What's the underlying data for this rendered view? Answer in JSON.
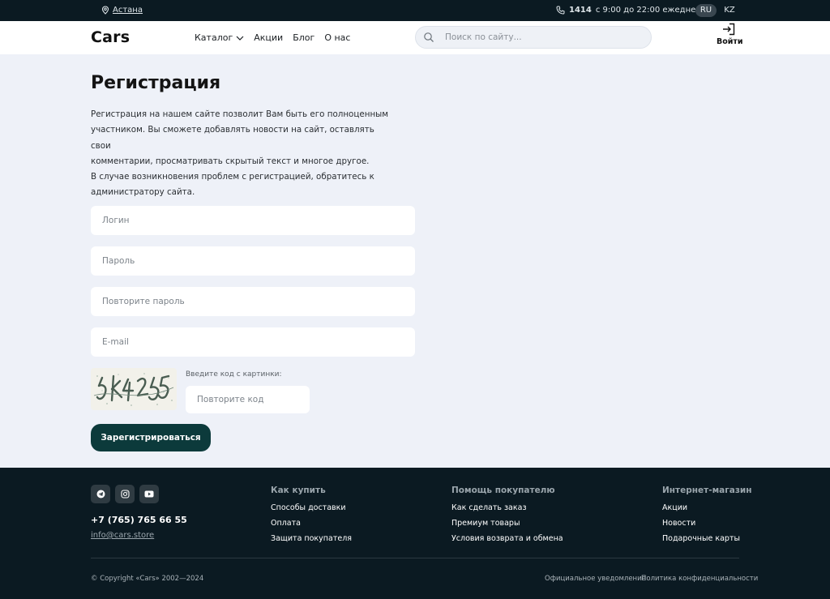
{
  "topbar": {
    "city": "Астана",
    "phone_short": "1414",
    "hours": "с 9:00 до 22:00 ежедневно",
    "lang_ru": "RU",
    "lang_kz": "KZ",
    "icons": [
      "map-pin-icon",
      "phone-icon"
    ]
  },
  "header": {
    "logo": "Cars",
    "nav": [
      "Каталог",
      "Акции",
      "Блог",
      "О нас"
    ],
    "search_placeholder": "Поиск по сайту...",
    "login_label": "Войти"
  },
  "page": {
    "title": "Регистрация",
    "intro_lines": [
      "Регистрация на нашем сайте позволит Вам быть его полноценным",
      "участником. Вы сможете добавлять новости на сайт, оставлять свои",
      "комментарии, просматривать скрытый текст и многое другое.",
      "В случае возникновения проблем с регистрацией, обратитесь к",
      "администратору сайта."
    ]
  },
  "form": {
    "login_placeholder": "Логин",
    "password_placeholder": "Пароль",
    "password_repeat_placeholder": "Повторите пароль",
    "email_placeholder": "E-mail",
    "captcha_label": "Введите код с картинки:",
    "captcha_placeholder": "Повторите код",
    "submit_label": "Зарегистрироваться"
  },
  "footer": {
    "phone": "+7 (765) 765 66 55",
    "email": "info@cars.store",
    "socials": [
      "telegram-icon",
      "instagram-icon",
      "youtube-icon"
    ],
    "columns": [
      {
        "title": "Как купить",
        "links": [
          "Способы доставки",
          "Оплата",
          "Защита покупателя"
        ]
      },
      {
        "title": "Помощь покупателю",
        "links": [
          "Как сделать заказ",
          "Премиум товары",
          "Условия возврата и обмена"
        ]
      },
      {
        "title": "Интернет-магазин",
        "links": [
          "Акции",
          "Новости",
          "Подарочные карты"
        ]
      }
    ],
    "copyright": "© Copyright «Cars» 2002—2024",
    "legal_notice": "Официальное уведомление",
    "privacy": "Политика конфиденциальности"
  },
  "colors": {
    "dark": "#0b1a22",
    "accent": "#0c3a3b",
    "background": "#eef1f8"
  }
}
